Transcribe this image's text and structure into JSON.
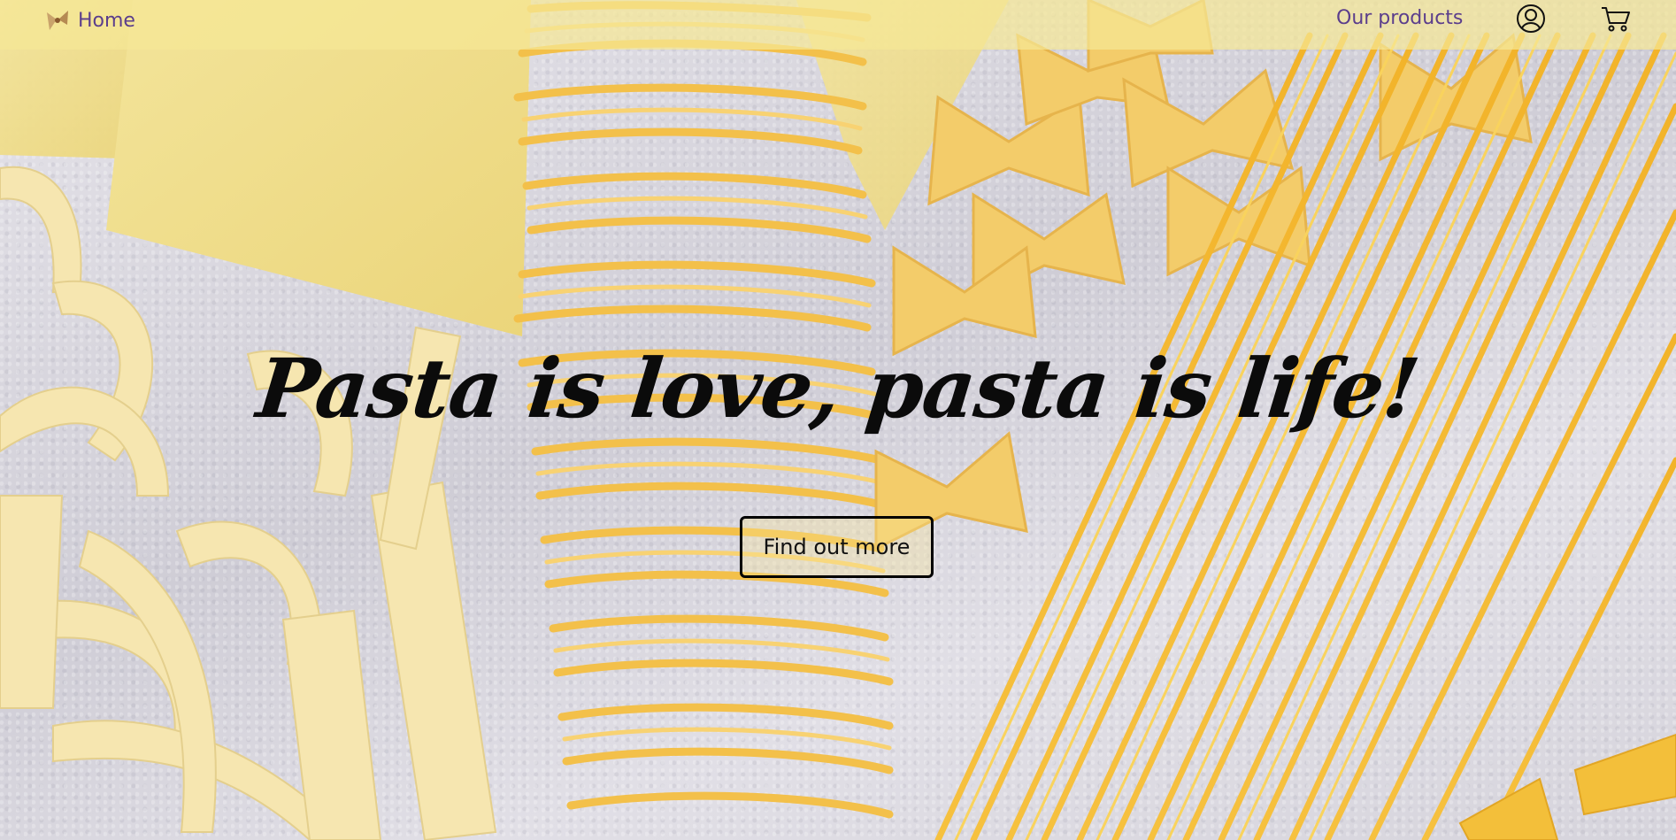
{
  "nav": {
    "home_label": "Home",
    "products_label": "Our products",
    "logo_icon": "bow-tie-pasta-logo",
    "user_icon": "user-account-icon",
    "cart_icon": "shopping-cart-icon",
    "bar_color": "#f5e896",
    "link_color": "#5b3e8c"
  },
  "hero": {
    "headline": "Pasta is love, pasta is life!",
    "cta_label": "Find out more",
    "background_image": "pasta-assortment-photo"
  }
}
